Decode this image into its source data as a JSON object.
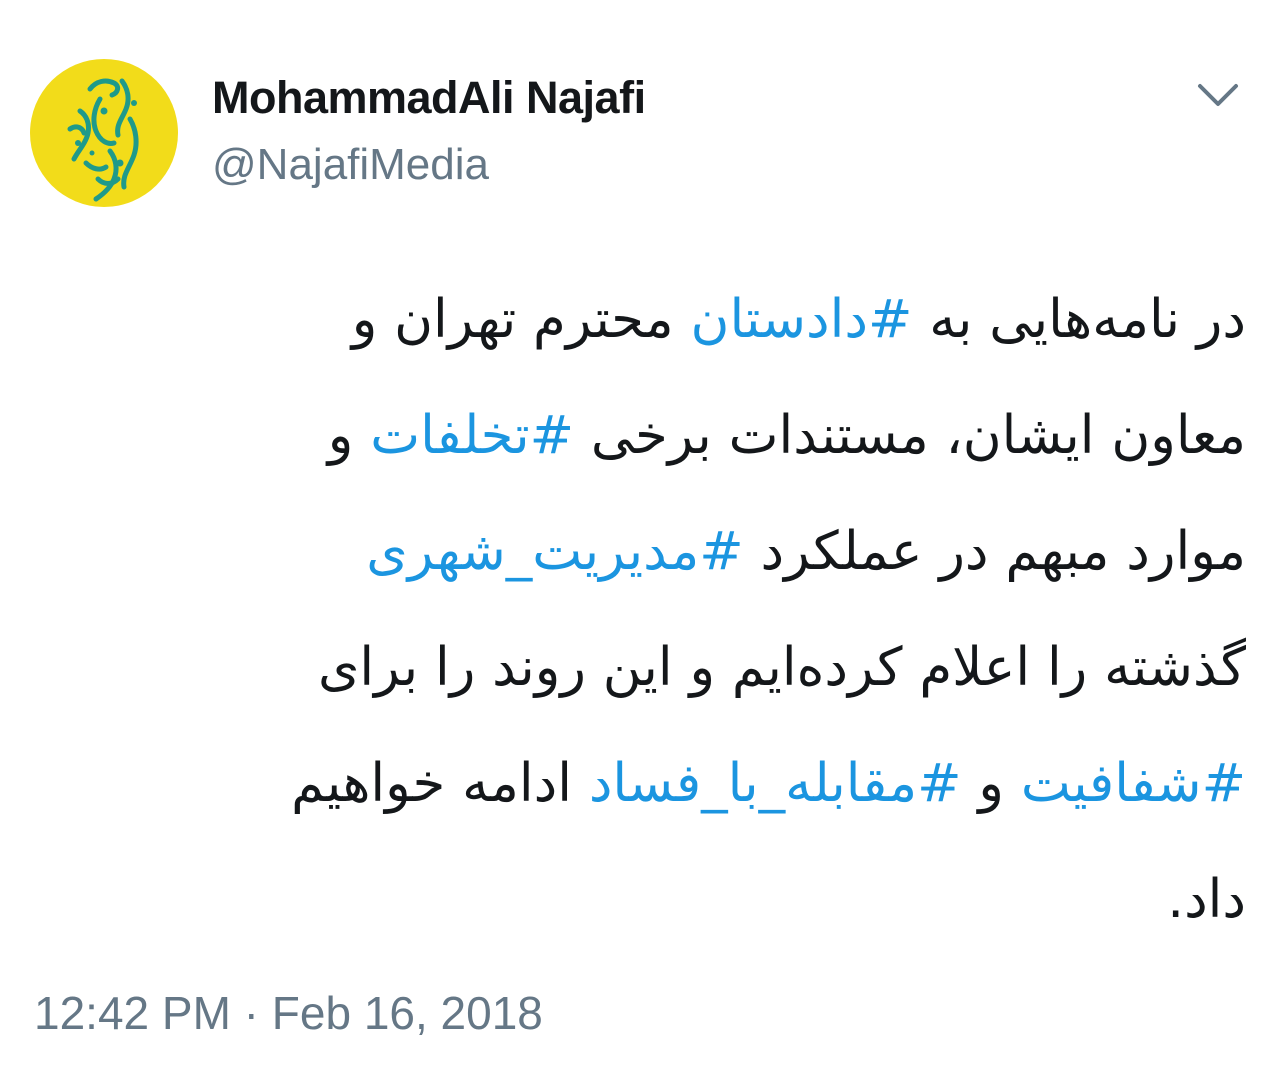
{
  "colors": {
    "avatar_background": "#f2dc1a",
    "avatar_figure": "#1f9a8a",
    "hashtag": "#1b95e0",
    "name": "#14171a",
    "meta": "#657786"
  },
  "user": {
    "display_name": "MohammadAli Najafi",
    "handle": "@NajafiMedia",
    "avatar_icon": "avatar-calligraphy-logo"
  },
  "menu": {
    "icon": "chevron-down-icon"
  },
  "tweet": {
    "lines": [
      [
        {
          "text": "در نامه‌هایی به ",
          "hashtag": false
        },
        {
          "text": "#دادستان",
          "hashtag": true
        },
        {
          "text": " محترم تهران و",
          "hashtag": false
        }
      ],
      [
        {
          "text": "معاون ایشان، مستندات برخی ",
          "hashtag": false
        },
        {
          "text": "#تخلفات",
          "hashtag": true
        },
        {
          "text": " و",
          "hashtag": false
        }
      ],
      [
        {
          "text": "موارد مبهم در عملکرد ",
          "hashtag": false
        },
        {
          "text": "#مدیریت_شهری",
          "hashtag": true
        }
      ],
      [
        {
          "text": "گذشته را اعلام کرده‌ایم و این روند را برای",
          "hashtag": false
        }
      ],
      [
        {
          "text": "#شفافیت",
          "hashtag": true
        },
        {
          "text": " و ",
          "hashtag": false
        },
        {
          "text": "#مقابله_با_فساد",
          "hashtag": true
        },
        {
          "text": " ادامه خواهیم",
          "hashtag": false
        }
      ],
      [
        {
          "text": "داد.",
          "hashtag": false
        }
      ]
    ],
    "timestamp": "12:42 PM · Feb 16, 2018"
  }
}
